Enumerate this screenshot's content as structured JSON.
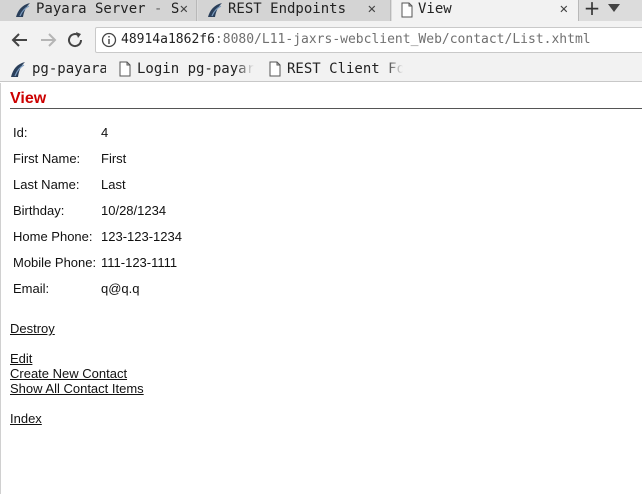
{
  "browser": {
    "tabs": [
      {
        "label": "Payara Server - S",
        "icon": "payara-fish-icon",
        "active": false
      },
      {
        "label": "REST Endpoints",
        "icon": "payara-fish-icon",
        "active": false
      },
      {
        "label": "View",
        "icon": "document-icon",
        "active": true
      }
    ],
    "close_glyph": "✕",
    "new_tab_glyph": "+",
    "url_host": "48914a1862f6",
    "url_rest": ":8080/L11-jaxrs-webclient_Web/contact/List.xhtml",
    "bookmarks": [
      {
        "label": "pg-payara",
        "icon": "payara-fish-icon"
      },
      {
        "label": "Login pg-payara",
        "icon": "document-icon"
      },
      {
        "label": "REST Client For",
        "icon": "document-icon"
      }
    ]
  },
  "page": {
    "title": "View",
    "fields": [
      {
        "label": "Id:",
        "value": "4"
      },
      {
        "label": "First Name:",
        "value": "First"
      },
      {
        "label": "Last Name:",
        "value": "Last"
      },
      {
        "label": "Birthday:",
        "value": "10/28/1234"
      },
      {
        "label": "Home Phone:",
        "value": "123-123-1234"
      },
      {
        "label": "Mobile Phone:",
        "value": "111-123-1111"
      },
      {
        "label": "Email:",
        "value": "q@q.q"
      }
    ],
    "links": {
      "destroy": "Destroy",
      "edit": "Edit",
      "create": "Create New Contact",
      "show_all": "Show All Contact Items",
      "index": "Index"
    }
  },
  "colors": {
    "title_red": "#cc0000",
    "chrome_gray": "#f2f2f2",
    "tab_gray": "#d4d4d4"
  }
}
